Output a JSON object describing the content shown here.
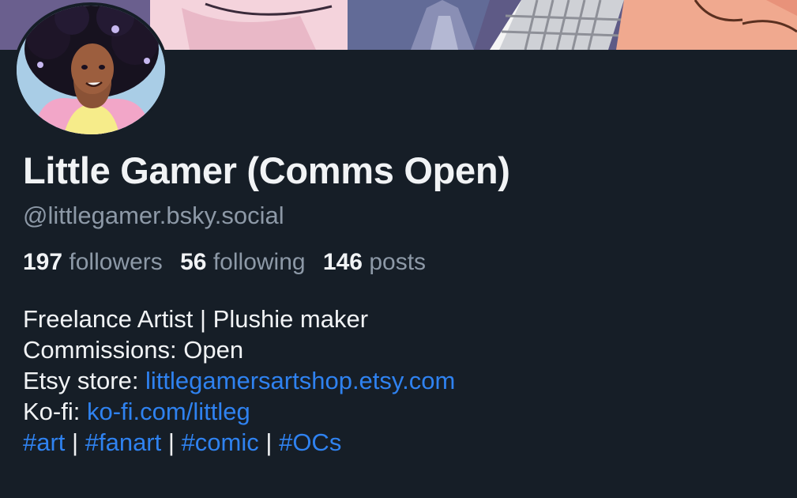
{
  "profile": {
    "display_name": "Little Gamer (Comms Open)",
    "handle": "@littlegamer.bsky.social"
  },
  "stats": {
    "followers_count": "197",
    "followers_label": "followers",
    "following_count": "56",
    "following_label": "following",
    "posts_count": "146",
    "posts_label": "posts"
  },
  "bio": {
    "line1": "Freelance Artist | Plushie maker",
    "line2": "Commissions: Open",
    "line3_prefix": "Etsy store: ",
    "line3_link": "littlegamersartshop.etsy.com",
    "line4_prefix": "Ko-fi: ",
    "line4_link": "ko-fi.com/littleg",
    "hashtags": [
      "#art",
      "#fanart",
      "#comic",
      "#OCs"
    ],
    "separator": "|"
  },
  "colors": {
    "background": "#161e27",
    "text_primary": "#f1f3f5",
    "text_secondary": "#8d99a7",
    "link": "#2f82f0"
  }
}
